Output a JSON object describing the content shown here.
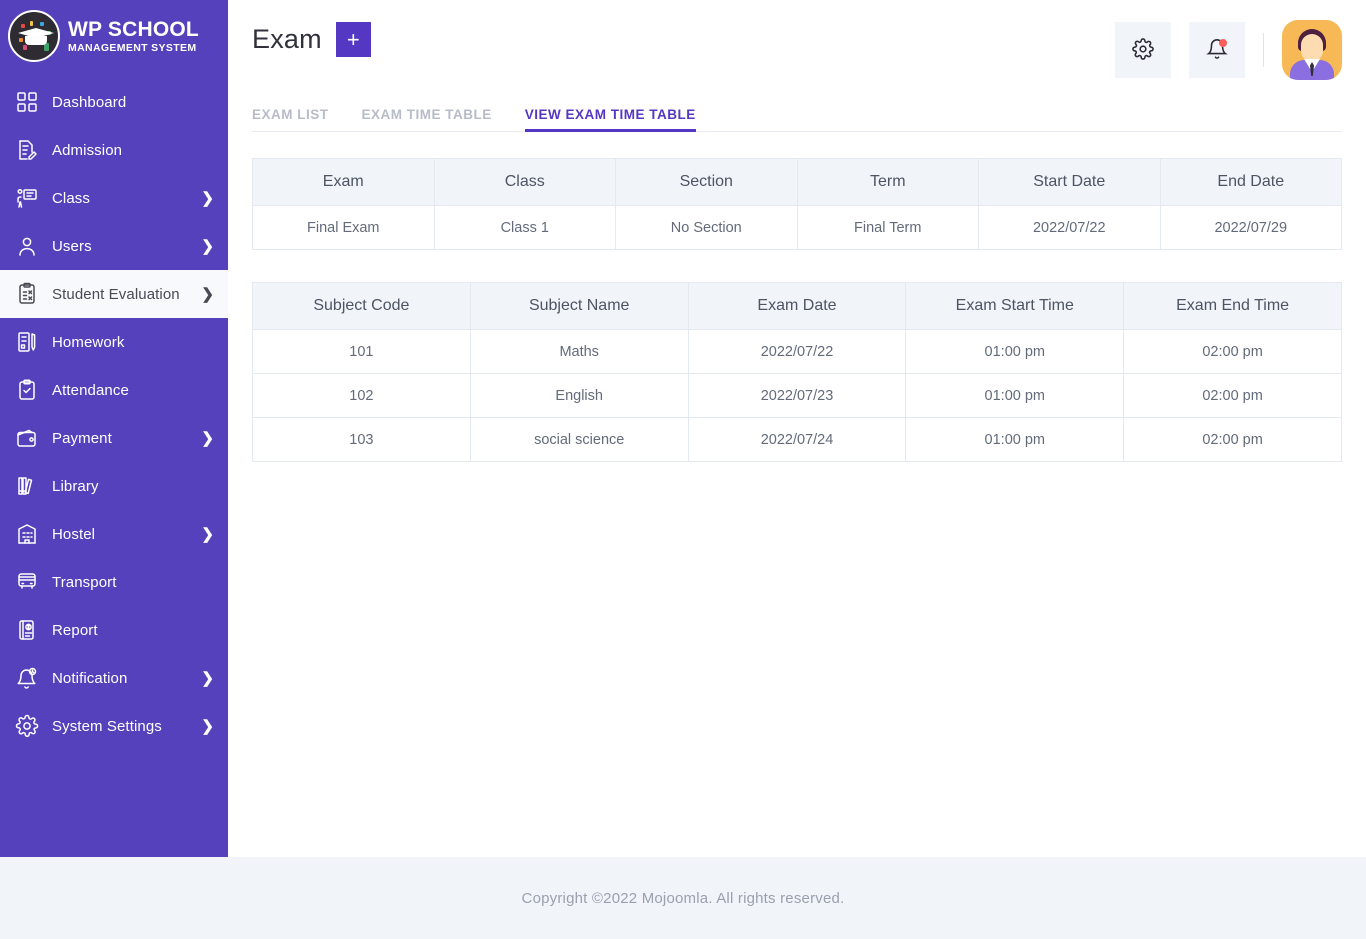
{
  "brand": {
    "title": "WP SCHOOL",
    "subtitle": "MANAGEMENT SYSTEM",
    "logo_icon": "graduation-cap-icon"
  },
  "sidebar": {
    "items": [
      {
        "label": "Dashboard",
        "icon": "grid-icon",
        "caret": "",
        "active": false
      },
      {
        "label": "Admission",
        "icon": "document-pen-icon",
        "caret": "",
        "active": false
      },
      {
        "label": "Class",
        "icon": "presentation-icon",
        "caret": "❯",
        "active": false
      },
      {
        "label": "Users",
        "icon": "user-icon",
        "caret": "❯",
        "active": false
      },
      {
        "label": "Student Evaluation",
        "icon": "clipboard-check-icon",
        "caret": "❯",
        "active": true
      },
      {
        "label": "Homework",
        "icon": "book-pencil-icon",
        "caret": "",
        "active": false
      },
      {
        "label": "Attendance",
        "icon": "clipboard-tick-icon",
        "caret": "",
        "active": false
      },
      {
        "label": "Payment",
        "icon": "wallet-icon",
        "caret": "❯",
        "active": false
      },
      {
        "label": "Library",
        "icon": "books-icon",
        "caret": "",
        "active": false
      },
      {
        "label": "Hostel",
        "icon": "building-icon",
        "caret": "❯",
        "active": false
      },
      {
        "label": "Transport",
        "icon": "bus-icon",
        "caret": "",
        "active": false
      },
      {
        "label": "Report",
        "icon": "report-icon",
        "caret": "",
        "active": false
      },
      {
        "label": "Notification",
        "icon": "bell-icon",
        "caret": "❯",
        "active": false
      },
      {
        "label": "System Settings",
        "icon": "gear-icon",
        "caret": "❯",
        "active": false
      }
    ]
  },
  "header": {
    "title": "Exam",
    "add_label": "+",
    "settings_icon": "gear-icon",
    "notification_icon": "bell-icon",
    "has_notification_dot": true,
    "avatar_icon": "user-avatar"
  },
  "tabs": [
    {
      "label": "EXAM LIST",
      "active": false
    },
    {
      "label": "EXAM TIME TABLE",
      "active": false
    },
    {
      "label": "VIEW EXAM TIME TABLE",
      "active": true
    }
  ],
  "exam_summary": {
    "columns": [
      "Exam",
      "Class",
      "Section",
      "Term",
      "Start Date",
      "End Date"
    ],
    "rows": [
      [
        "Final Exam",
        "Class 1",
        "No Section",
        "Final Term",
        "2022/07/22",
        "2022/07/29"
      ]
    ]
  },
  "timetable": {
    "columns": [
      "Subject Code",
      "Subject Name",
      "Exam Date",
      "Exam Start Time",
      "Exam End Time"
    ],
    "rows": [
      [
        "101",
        "Maths",
        "2022/07/22",
        "01:00 pm",
        "02:00 pm"
      ],
      [
        "102",
        "English",
        "2022/07/23",
        "01:00 pm",
        "02:00 pm"
      ],
      [
        "103",
        "social science",
        "2022/07/24",
        "01:00 pm",
        "02:00 pm"
      ]
    ]
  },
  "footer": {
    "text": "Copyright ©2022 Mojoomla. All rights reserved."
  },
  "colors": {
    "sidebar": "#5441bb",
    "accent": "#5437c2",
    "table_header": "#f1f4f9",
    "footer_bg": "#f1f4f9",
    "notification_dot": "#fc5c5c",
    "avatar_bg": "#f7b955"
  }
}
